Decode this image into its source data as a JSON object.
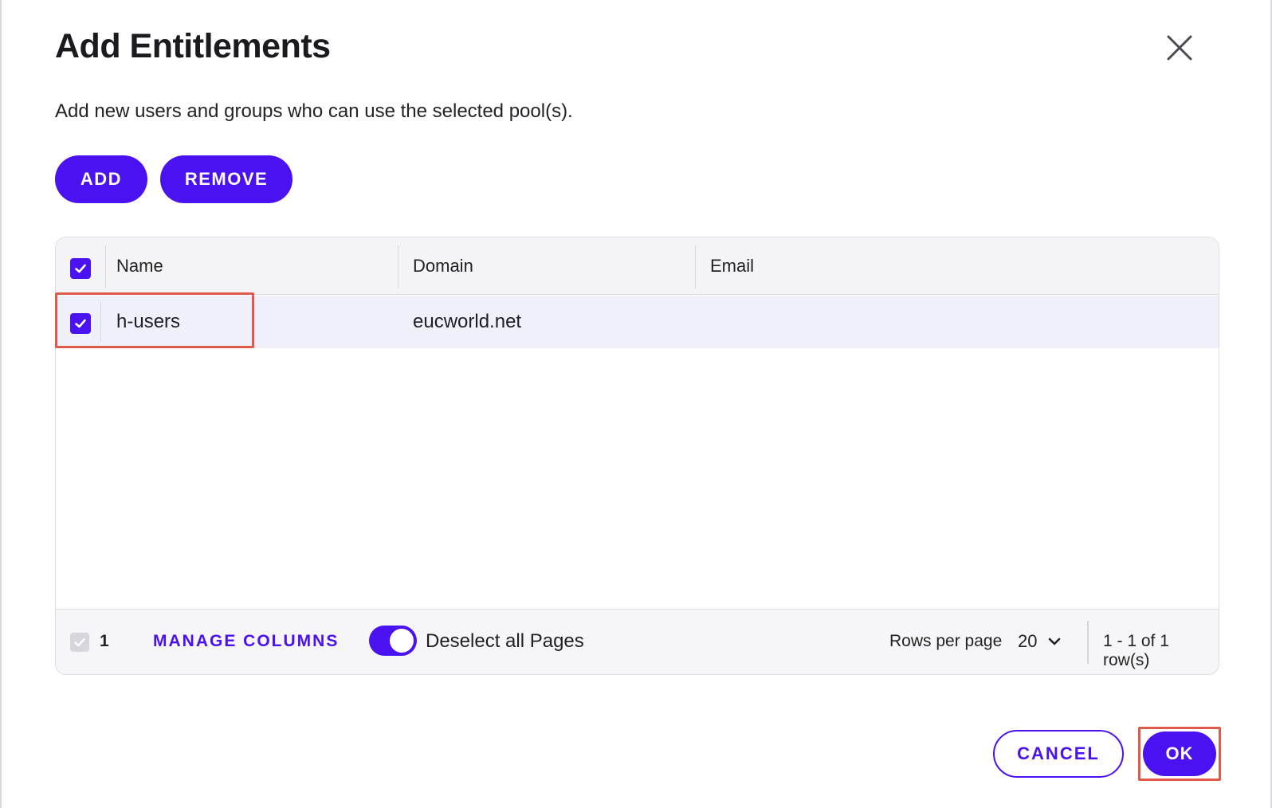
{
  "dialog": {
    "title": "Add Entitlements",
    "subtitle": "Add new users and groups who can use the selected pool(s).",
    "close_icon": "close-icon"
  },
  "toolbar": {
    "add_label": "ADD",
    "remove_label": "REMOVE"
  },
  "table": {
    "columns": [
      "Name",
      "Domain",
      "Email"
    ],
    "select_all_checked": true,
    "rows": [
      {
        "checked": true,
        "name": "h-users",
        "domain": "eucworld.net",
        "email": ""
      }
    ]
  },
  "footer": {
    "selected_count": "1",
    "manage_columns_label": "MANAGE COLUMNS",
    "deselect_toggle_on": true,
    "deselect_label": "Deselect all Pages",
    "rows_per_page_label": "Rows per page",
    "rows_per_page_value": "20",
    "range_text": "1 - 1 of 1 row(s)"
  },
  "actions": {
    "cancel_label": "CANCEL",
    "ok_label": "OK"
  },
  "colors": {
    "accent": "#4a12f0",
    "highlight": "#e05a4c",
    "selected_row_bg": "#eff0fa"
  }
}
